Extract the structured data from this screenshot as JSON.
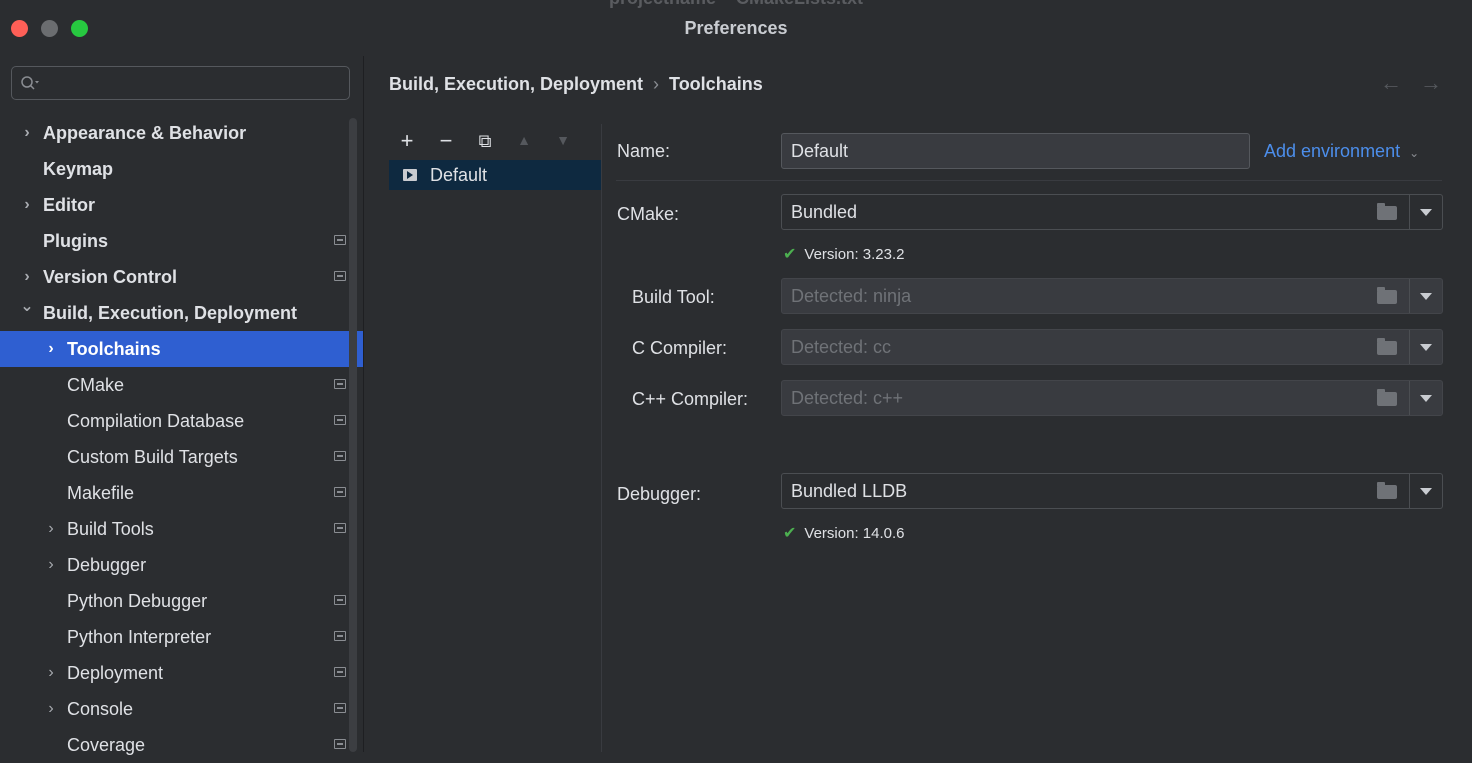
{
  "window": {
    "title": "Preferences",
    "background_title": "projectname – CMakeLists.txt"
  },
  "sidebar": {
    "search": {
      "value": "",
      "placeholder": ""
    },
    "items": [
      {
        "label": "Appearance & Behavior",
        "expandable": true,
        "expanded": false,
        "level": 0,
        "bold": true
      },
      {
        "label": "Keymap",
        "expandable": false,
        "level": 0,
        "bold": true
      },
      {
        "label": "Editor",
        "expandable": true,
        "expanded": false,
        "level": 0,
        "bold": true
      },
      {
        "label": "Plugins",
        "expandable": false,
        "level": 0,
        "bold": true,
        "project_icon": true
      },
      {
        "label": "Version Control",
        "expandable": true,
        "expanded": false,
        "level": 0,
        "bold": true,
        "project_icon": true
      },
      {
        "label": "Build, Execution, Deployment",
        "expandable": true,
        "expanded": true,
        "level": 0,
        "bold": true
      },
      {
        "label": "Toolchains",
        "expandable": true,
        "expanded": false,
        "level": 1,
        "bold": true,
        "selected": true
      },
      {
        "label": "CMake",
        "expandable": false,
        "level": 1,
        "project_icon": true
      },
      {
        "label": "Compilation Database",
        "expandable": false,
        "level": 1,
        "project_icon": true
      },
      {
        "label": "Custom Build Targets",
        "expandable": false,
        "level": 1,
        "project_icon": true
      },
      {
        "label": "Makefile",
        "expandable": false,
        "level": 1,
        "project_icon": true
      },
      {
        "label": "Build Tools",
        "expandable": true,
        "expanded": false,
        "level": 1,
        "project_icon": true
      },
      {
        "label": "Debugger",
        "expandable": true,
        "expanded": false,
        "level": 1
      },
      {
        "label": "Python Debugger",
        "expandable": false,
        "level": 1,
        "project_icon": true
      },
      {
        "label": "Python Interpreter",
        "expandable": false,
        "level": 1,
        "project_icon": true
      },
      {
        "label": "Deployment",
        "expandable": true,
        "expanded": false,
        "level": 1,
        "project_icon": true
      },
      {
        "label": "Console",
        "expandable": true,
        "expanded": false,
        "level": 1,
        "project_icon": true
      },
      {
        "label": "Coverage",
        "expandable": false,
        "level": 1,
        "project_icon": true
      }
    ]
  },
  "breadcrumb": {
    "parent": "Build, Execution, Deployment",
    "separator": "›",
    "current": "Toolchains"
  },
  "nav": {
    "back": "←",
    "forward": "→"
  },
  "toolchains": {
    "toolbar": {
      "add": "+",
      "remove": "−",
      "copy": "⧉",
      "up": "▲",
      "down": "▼"
    },
    "items": [
      {
        "label": "Default",
        "selected": true
      }
    ]
  },
  "form": {
    "name": {
      "label": "Name:",
      "value": "Default"
    },
    "add_environment": "Add environment",
    "cmake": {
      "label": "CMake:",
      "value": "Bundled",
      "version": "Version: 3.23.2"
    },
    "build_tool": {
      "label": "Build Tool:",
      "placeholder": "Detected: ninja"
    },
    "c_compiler": {
      "label": "C Compiler:",
      "placeholder": "Detected: cc"
    },
    "cpp_compiler": {
      "label": "C++ Compiler:",
      "placeholder": "Detected: c++"
    },
    "debugger": {
      "label": "Debugger:",
      "value": "Bundled LLDB",
      "version": "Version: 14.0.6"
    }
  },
  "colors": {
    "background": "#2b2d30",
    "selection": "#2f5fd1",
    "link": "#4c8eeb",
    "check": "#4caf50"
  }
}
